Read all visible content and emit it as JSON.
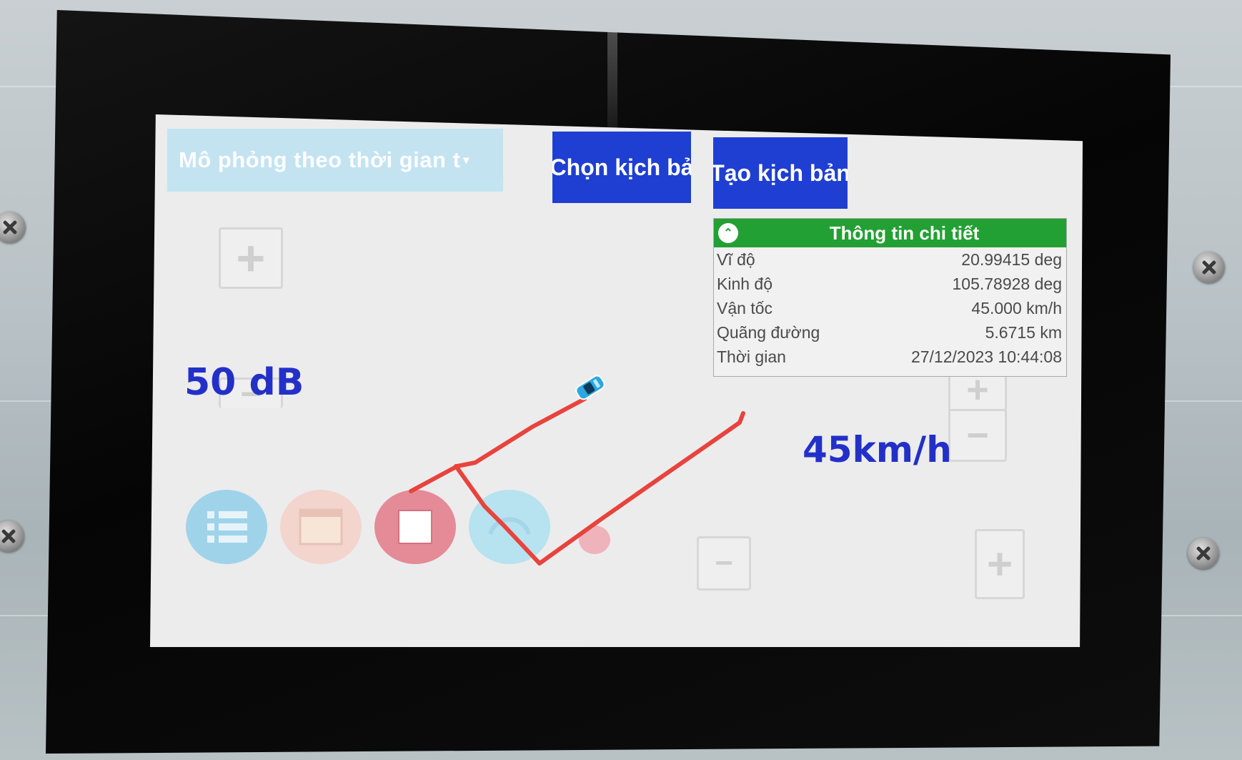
{
  "toolbar": {
    "simulation_mode": "Mô phỏng theo thời gian t",
    "choose_scenario_label": "Chọn kịch bả",
    "create_scenario_label": "Tạo kịch bản"
  },
  "info_panel": {
    "title": "Thông tin chi tiết",
    "rows": [
      {
        "label": "Vĩ độ",
        "value": "20.99415 deg"
      },
      {
        "label": "Kinh độ",
        "value": "105.78928 deg"
      },
      {
        "label": "Vận tốc",
        "value": "45.000 km/h"
      },
      {
        "label": "Quãng đường",
        "value": "5.6715 km"
      },
      {
        "label": "Thời gian",
        "value": "27/12/2023 10:44:08"
      }
    ]
  },
  "volume": {
    "display": "50 dB"
  },
  "speed": {
    "display": "45km/h"
  },
  "colors": {
    "accent_blue": "#1f3fd2",
    "header_green": "#23a033",
    "track_red": "#e8433c",
    "label_blue": "#2330c8"
  },
  "icons": {
    "menu": "list-icon",
    "map": "map-icon",
    "stop": "stop-icon",
    "gauge": "gauge-icon",
    "record": "record-dot-icon",
    "vehicle": "car-icon"
  }
}
